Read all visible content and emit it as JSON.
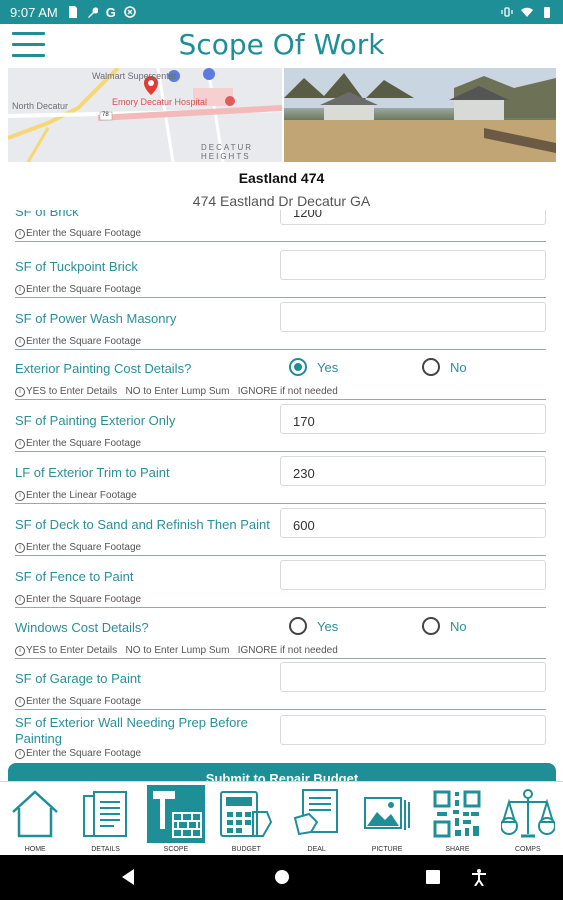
{
  "status_bar": {
    "time": "9:07 AM",
    "left_icons": [
      "sd-card-icon",
      "wrench-icon",
      "google-icon",
      "sync-icon"
    ],
    "right_icons": [
      "vibrate-icon",
      "wifi-icon",
      "battery-icon"
    ]
  },
  "header": {
    "title": "Scope Of Work"
  },
  "map": {
    "labels": [
      "Walmart Supercenter",
      "North Decatur",
      "Emory Decatur Hospital",
      "DECATUR",
      "HEIGHTS",
      "78"
    ]
  },
  "property": {
    "name": "Eastland 474",
    "address": "474 Eastland Dr Decatur GA"
  },
  "form": {
    "rows": [
      {
        "label": "SF of Brick",
        "value": "1200",
        "hint": "Enter the Square Footage"
      },
      {
        "label": "SF of Tuckpoint Brick",
        "value": "",
        "hint": "Enter the Square Footage"
      },
      {
        "label": "SF of Power Wash Masonry",
        "value": "",
        "hint": "Enter the Square Footage"
      },
      {
        "label": "Exterior Painting Cost Details?",
        "yes": "Yes",
        "no": "No",
        "selected": "yes",
        "hint": "YES to Enter Details   NO to Enter Lump Sum   IGNORE if not needed"
      },
      {
        "label": "SF of Painting Exterior Only",
        "value": "170",
        "hint": "Enter the Square Footage"
      },
      {
        "label": "LF of Exterior Trim to Paint",
        "value": "230",
        "hint": "Enter the Linear Footage"
      },
      {
        "label": "SF of Deck to Sand and Refinish Then Paint",
        "value": "600",
        "hint": "Enter the Square Footage"
      },
      {
        "label": "SF of Fence to Paint",
        "value": "",
        "hint": "Enter the Square Footage"
      },
      {
        "label": "Windows Cost Details?",
        "yes": "Yes",
        "no": "No",
        "selected": "",
        "hint": "YES to Enter Details   NO to Enter Lump Sum   IGNORE if not needed"
      },
      {
        "label": "SF of Garage to Paint",
        "value": "",
        "hint": "Enter the Square Footage"
      },
      {
        "label": "SF of Exterior Wall Needing Prep Before",
        "label2": "Painting",
        "value": "",
        "hint": "Enter the Square Footage"
      }
    ]
  },
  "submit": {
    "label": "Submit to Repair Budget"
  },
  "nav": {
    "items": [
      {
        "label": "HOME",
        "icon": "house-icon"
      },
      {
        "label": "DETAILS",
        "icon": "document-icon"
      },
      {
        "label": "SCOPE",
        "icon": "hammer-brick-icon",
        "active": true
      },
      {
        "label": "BUDGET",
        "icon": "calculator-icon"
      },
      {
        "label": "DEAL",
        "icon": "handshake-icon"
      },
      {
        "label": "PICTURE",
        "icon": "picture-icon"
      },
      {
        "label": "SHARE",
        "icon": "qr-code-icon"
      },
      {
        "label": "COMPS",
        "icon": "scales-icon"
      }
    ]
  },
  "colors": {
    "accent": "#1f8f97",
    "label": "#2a8f99",
    "divider": "#9aa7aa"
  }
}
